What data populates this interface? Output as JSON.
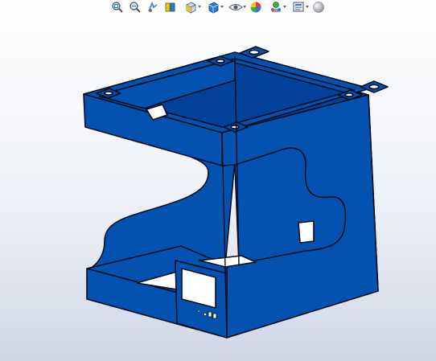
{
  "viewport": {
    "background_top": "#ffffff",
    "background_bottom": "#cfd6e6"
  },
  "toolbar": {
    "buttons": [
      {
        "icon": "zoom-to-fit-icon"
      },
      {
        "icon": "zoom-to-area-icon"
      },
      {
        "icon": "previous-view-icon"
      },
      {
        "icon": "section-view-icon"
      },
      {
        "icon": "view-orientation-icon",
        "dropdown": true
      },
      {
        "icon": "display-style-icon",
        "dropdown": true
      },
      {
        "icon": "hide-show-items-icon",
        "dropdown": true
      },
      {
        "icon": "edit-appearance-icon"
      },
      {
        "icon": "apply-scene-icon",
        "dropdown": true
      },
      {
        "icon": "view-settings-icon",
        "dropdown": true
      },
      {
        "icon": "realview-icon"
      }
    ]
  },
  "model": {
    "part_color": "#0352b0",
    "part_color_dark": "#02419a",
    "edge_color": "#050d1e",
    "cutout_color": "#ffffff"
  }
}
